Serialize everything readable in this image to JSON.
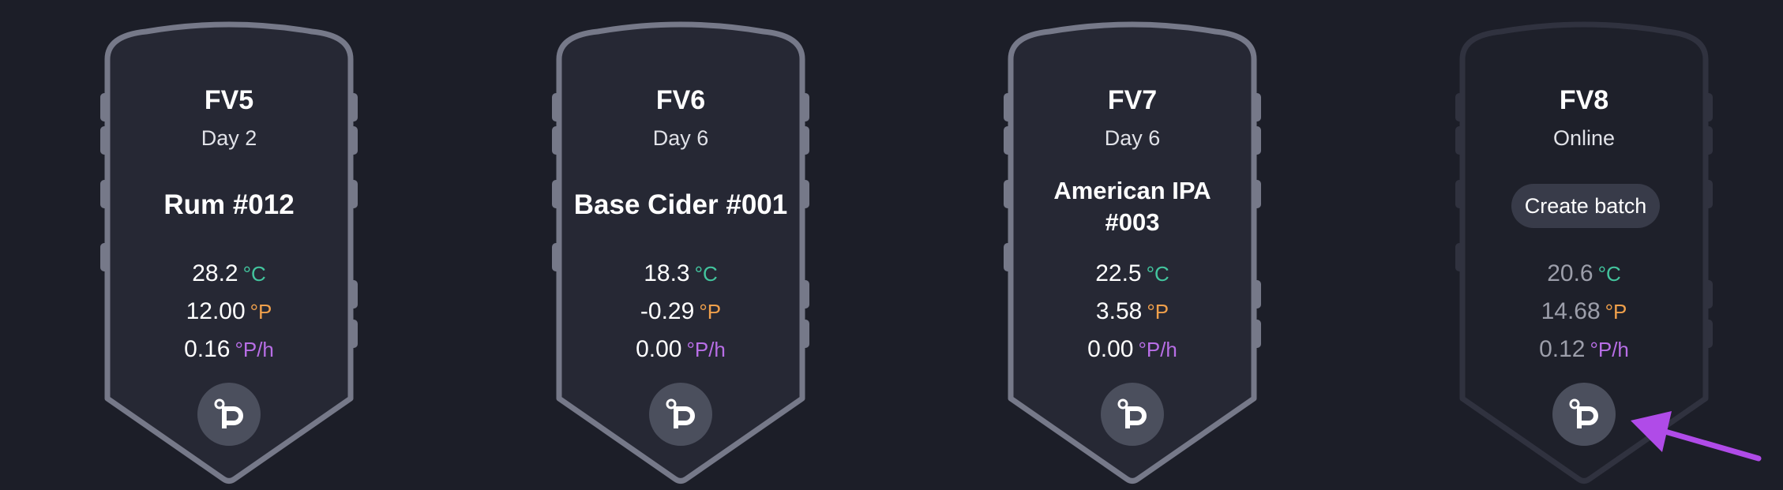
{
  "tanks": [
    {
      "name": "FV5",
      "status": "Day 2",
      "batch": "Rum #012",
      "temperature": "28.2",
      "gravity": "12.00",
      "rate": "0.16"
    },
    {
      "name": "FV6",
      "status": "Day 6",
      "batch": "Base Cider #001",
      "temperature": "18.3",
      "gravity": "-0.29",
      "rate": "0.00"
    },
    {
      "name": "FV7",
      "status": "Day 6",
      "batch_line1": "American IPA",
      "batch_line2": "#003",
      "temperature": "22.5",
      "gravity": "3.58",
      "rate": "0.00"
    },
    {
      "name": "FV8",
      "status": "Online",
      "create_label": "Create batch",
      "temperature": "20.6",
      "gravity": "14.68",
      "rate": "0.12"
    }
  ],
  "units": {
    "temperature": "°C",
    "gravity": "°P",
    "rate": "°P/h"
  },
  "icons": {
    "device": "plaato-logo-icon",
    "annotation": "arrow-icon"
  },
  "colors": {
    "background": "#1c1e28",
    "tank_fill": "#262834",
    "tank_outline": "#767989",
    "tank_outline_offline": "#30323f",
    "temperature_unit": "#43c59e",
    "gravity_unit": "#f0a04b",
    "rate_unit": "#b86ee6",
    "arrow": "#b04be8"
  }
}
